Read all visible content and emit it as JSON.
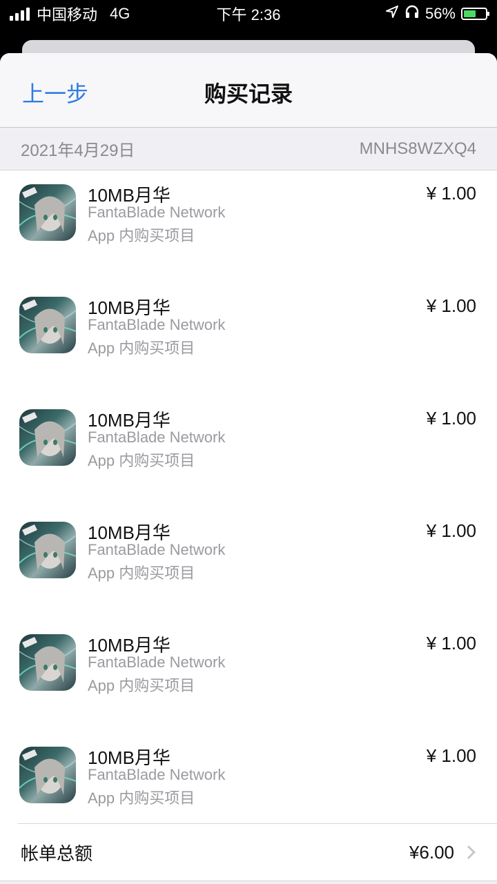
{
  "status_bar": {
    "carrier": "中国移动",
    "network": "4G",
    "time": "下午 2:36",
    "battery_percent": "56%",
    "battery_level": 0.56,
    "icons": [
      "signal-icon",
      "location-icon",
      "headphones-icon",
      "battery-charging-icon"
    ]
  },
  "nav": {
    "back_label": "上一步",
    "title": "购买记录"
  },
  "section": {
    "date": "2021年4月29日",
    "order_id": "MNHS8WZXQ4"
  },
  "items": [
    {
      "title": "10MB月华",
      "developer": "FantaBlade Network",
      "type": "App 内购买项目",
      "price": "¥ 1.00"
    },
    {
      "title": "10MB月华",
      "developer": "FantaBlade Network",
      "type": "App 内购买项目",
      "price": "¥ 1.00"
    },
    {
      "title": "10MB月华",
      "developer": "FantaBlade Network",
      "type": "App 内购买项目",
      "price": "¥ 1.00"
    },
    {
      "title": "10MB月华",
      "developer": "FantaBlade Network",
      "type": "App 内购买项目",
      "price": "¥ 1.00"
    },
    {
      "title": "10MB月华",
      "developer": "FantaBlade Network",
      "type": "App 内购买项目",
      "price": "¥ 1.00"
    },
    {
      "title": "10MB月华",
      "developer": "FantaBlade Network",
      "type": "App 内购买项目",
      "price": "¥ 1.00"
    }
  ],
  "total": {
    "label": "帐单总额",
    "value": "¥6.00"
  },
  "colors": {
    "accent": "#2f7de1",
    "battery": "#4cd964",
    "secondary_text": "#9a9aa0"
  }
}
